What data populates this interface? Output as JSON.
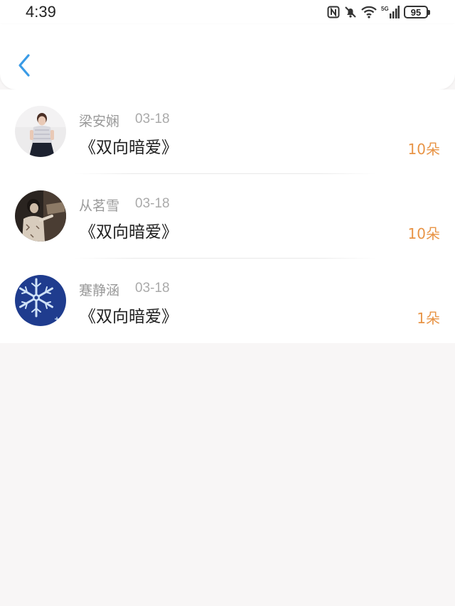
{
  "status_bar": {
    "time": "4:39",
    "battery": "95",
    "network": "5G",
    "icons": [
      "nfc-icon",
      "bell-off-icon",
      "wifi-icon",
      "signal-icon",
      "battery-icon"
    ]
  },
  "header": {
    "back_icon": "chevron-left-icon"
  },
  "colors": {
    "accent": "#3a9be6",
    "count": "#e89446",
    "muted_text": "#999999",
    "background": "#f8f6f6"
  },
  "items": [
    {
      "name": "梁安娴",
      "date": "03-18",
      "title": "《双向暗爱》",
      "count": "10朵",
      "avatar": "woman-photo-avatar"
    },
    {
      "name": "从茗雪",
      "date": "03-18",
      "title": "《双向暗爱》",
      "count": "10朵",
      "avatar": "sepia-photo-avatar"
    },
    {
      "name": "蹇静涵",
      "date": "03-18",
      "title": "《双向暗爱》",
      "count": "1朵",
      "avatar": "snowflake-avatar"
    }
  ]
}
